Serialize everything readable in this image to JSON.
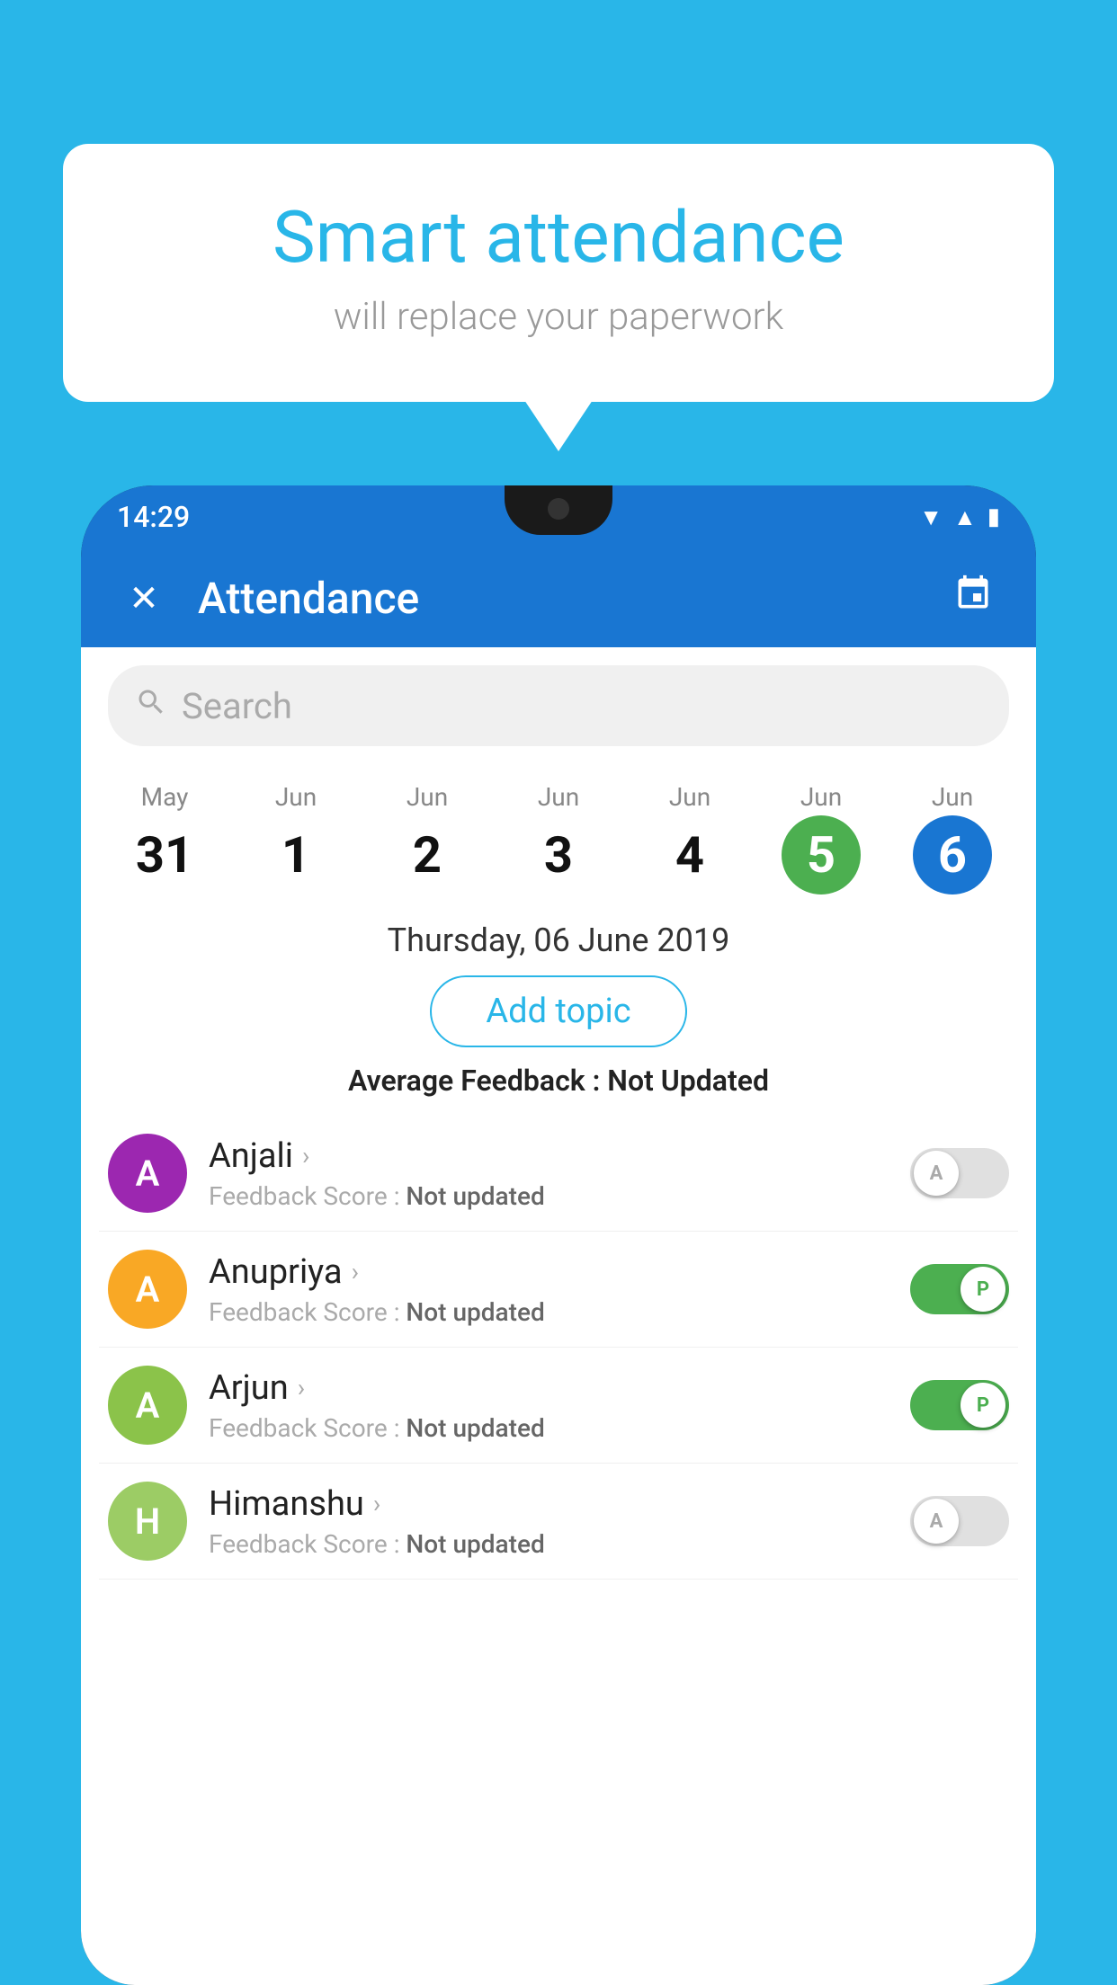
{
  "background_color": "#29b6e8",
  "bubble": {
    "title": "Smart attendance",
    "subtitle": "will replace your paperwork"
  },
  "status_bar": {
    "time": "14:29",
    "icons": [
      "wifi",
      "signal",
      "battery"
    ]
  },
  "app_bar": {
    "title": "Attendance",
    "close_label": "×",
    "calendar_label": "📅"
  },
  "search": {
    "placeholder": "Search"
  },
  "dates": [
    {
      "month": "May",
      "day": "31",
      "selected": false
    },
    {
      "month": "Jun",
      "day": "1",
      "selected": false
    },
    {
      "month": "Jun",
      "day": "2",
      "selected": false
    },
    {
      "month": "Jun",
      "day": "3",
      "selected": false
    },
    {
      "month": "Jun",
      "day": "4",
      "selected": false
    },
    {
      "month": "Jun",
      "day": "5",
      "selected": "today"
    },
    {
      "month": "Jun",
      "day": "6",
      "selected": "blue"
    }
  ],
  "selected_date_label": "Thursday, 06 June 2019",
  "add_topic_label": "Add topic",
  "avg_feedback_label": "Average Feedback :",
  "avg_feedback_value": "Not Updated",
  "students": [
    {
      "name": "Anjali",
      "feedback_label": "Feedback Score :",
      "feedback_value": "Not updated",
      "avatar_letter": "A",
      "avatar_color": "purple",
      "toggle": "off",
      "toggle_letter": "A"
    },
    {
      "name": "Anupriya",
      "feedback_label": "Feedback Score :",
      "feedback_value": "Not updated",
      "avatar_letter": "A",
      "avatar_color": "yellow",
      "toggle": "on",
      "toggle_letter": "P"
    },
    {
      "name": "Arjun",
      "feedback_label": "Feedback Score :",
      "feedback_value": "Not updated",
      "avatar_letter": "A",
      "avatar_color": "green",
      "toggle": "on",
      "toggle_letter": "P"
    },
    {
      "name": "Himanshu",
      "feedback_label": "Feedback Score :",
      "feedback_value": "Not updated",
      "avatar_letter": "H",
      "avatar_color": "olive",
      "toggle": "off",
      "toggle_letter": "A"
    }
  ]
}
